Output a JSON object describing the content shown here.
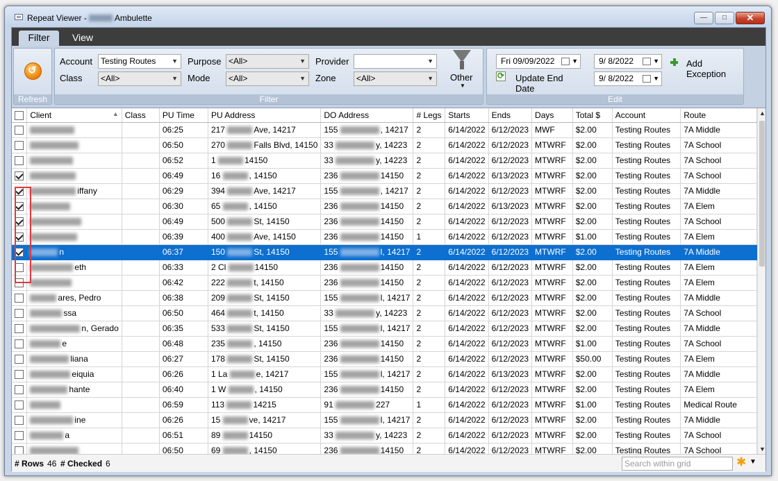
{
  "window": {
    "title_prefix": "Repeat Viewer -",
    "title_suffix": "Ambulette",
    "controls": {
      "minimize": "—",
      "maximize": "□",
      "close": "✕"
    }
  },
  "tabs": [
    {
      "label": "Filter",
      "active": true
    },
    {
      "label": "View",
      "active": false
    }
  ],
  "ribbon": {
    "refresh_caption": "Refresh",
    "filter": {
      "caption": "Filter",
      "account_label": "Account",
      "account_value": "Testing Routes",
      "class_label": "Class",
      "class_value": "<All>",
      "purpose_label": "Purpose",
      "purpose_value": "<All>",
      "mode_label": "Mode",
      "mode_value": "<All>",
      "provider_label": "Provider",
      "provider_value": "",
      "zone_label": "Zone",
      "zone_value": "<All>",
      "other_label": "Other"
    },
    "edit": {
      "caption": "Edit",
      "end_date_value": "Fri  09/09/2022",
      "update_end_date_label": "Update End Date",
      "exception_date1": "9/  8/2022",
      "exception_date2": "9/  8/2022",
      "add_exception_label": "Add Exception"
    }
  },
  "grid": {
    "columns": [
      "Client",
      "Class",
      "PU Time",
      "PU Address",
      "DO Address",
      "# Legs",
      "Starts",
      "Ends",
      "Days",
      "Total $",
      "Account",
      "Route"
    ],
    "rows": [
      {
        "checked": false,
        "selected": false,
        "client": "",
        "pu_time": "06:25",
        "pu_pre": "217",
        "pu_post": "Ave, 14217",
        "do_pre": "155",
        "do_post": ", 14217",
        "legs": "2",
        "starts": "6/14/2022",
        "ends": "6/12/2023",
        "days": "MWF",
        "total": "$2.00",
        "account": "Testing Routes",
        "route": "7A Middle"
      },
      {
        "checked": false,
        "selected": false,
        "client": "",
        "pu_time": "06:50",
        "pu_pre": "270",
        "pu_post": "Falls Blvd, 14150",
        "do_pre": "33",
        "do_post": "y, 14223",
        "legs": "2",
        "starts": "6/14/2022",
        "ends": "6/12/2023",
        "days": "MTWRF",
        "total": "$2.00",
        "account": "Testing Routes",
        "route": "7A School"
      },
      {
        "checked": false,
        "selected": false,
        "client": "",
        "pu_time": "06:52",
        "pu_pre": "1",
        "pu_post": "14150",
        "do_pre": "33",
        "do_post": "y, 14223",
        "legs": "2",
        "starts": "6/14/2022",
        "ends": "6/12/2023",
        "days": "MTWRF",
        "total": "$2.00",
        "account": "Testing Routes",
        "route": "7A School"
      },
      {
        "checked": true,
        "selected": false,
        "client": "",
        "pu_time": "06:49",
        "pu_pre": "16",
        "pu_post": ", 14150",
        "do_pre": "236",
        "do_post": "14150",
        "legs": "2",
        "starts": "6/14/2022",
        "ends": "6/13/2023",
        "days": "MTWRF",
        "total": "$2.00",
        "account": "Testing Routes",
        "route": "7A School"
      },
      {
        "checked": true,
        "selected": false,
        "client": "iffany",
        "pu_time": "06:29",
        "pu_pre": "394",
        "pu_post": "Ave, 14217",
        "do_pre": "155",
        "do_post": ", 14217",
        "legs": "2",
        "starts": "6/14/2022",
        "ends": "6/12/2023",
        "days": "MTWRF",
        "total": "$2.00",
        "account": "Testing Routes",
        "route": "7A Middle"
      },
      {
        "checked": true,
        "selected": false,
        "client": "",
        "pu_time": "06:30",
        "pu_pre": "65",
        "pu_post": ", 14150",
        "do_pre": "236",
        "do_post": "14150",
        "legs": "2",
        "starts": "6/14/2022",
        "ends": "6/13/2023",
        "days": "MTWRF",
        "total": "$2.00",
        "account": "Testing Routes",
        "route": "7A Elem"
      },
      {
        "checked": true,
        "selected": false,
        "client": "",
        "pu_time": "06:49",
        "pu_pre": "500",
        "pu_post": "St, 14150",
        "do_pre": "236",
        "do_post": "14150",
        "legs": "2",
        "starts": "6/14/2022",
        "ends": "6/12/2023",
        "days": "MTWRF",
        "total": "$2.00",
        "account": "Testing Routes",
        "route": "7A School"
      },
      {
        "checked": true,
        "selected": false,
        "client": "",
        "pu_time": "06:39",
        "pu_pre": "400",
        "pu_post": "Ave, 14150",
        "do_pre": "236",
        "do_post": "14150",
        "legs": "1",
        "starts": "6/14/2022",
        "ends": "6/12/2023",
        "days": "MTWRF",
        "total": "$1.00",
        "account": "Testing Routes",
        "route": "7A Elem"
      },
      {
        "checked": true,
        "selected": true,
        "client": "n",
        "pu_time": "06:37",
        "pu_pre": "150",
        "pu_post": "St, 14150",
        "do_pre": "155",
        "do_post": "l, 14217",
        "legs": "2",
        "starts": "6/14/2022",
        "ends": "6/12/2023",
        "days": "MTWRF",
        "total": "$2.00",
        "account": "Testing Routes",
        "route": "7A Middle"
      },
      {
        "checked": false,
        "selected": false,
        "client": "eth",
        "pu_time": "06:33",
        "pu_pre": "2 Cl",
        "pu_post": "14150",
        "do_pre": "236",
        "do_post": "14150",
        "legs": "2",
        "starts": "6/14/2022",
        "ends": "6/12/2023",
        "days": "MTWRF",
        "total": "$2.00",
        "account": "Testing Routes",
        "route": "7A Elem"
      },
      {
        "checked": false,
        "selected": false,
        "client": "",
        "pu_time": "06:42",
        "pu_pre": "222",
        "pu_post": "t, 14150",
        "do_pre": "236",
        "do_post": "14150",
        "legs": "2",
        "starts": "6/14/2022",
        "ends": "6/12/2023",
        "days": "MTWRF",
        "total": "$2.00",
        "account": "Testing Routes",
        "route": "7A Elem"
      },
      {
        "checked": false,
        "selected": false,
        "client": "ares, Pedro",
        "pu_time": "06:38",
        "pu_pre": "209",
        "pu_post": "St, 14150",
        "do_pre": "155",
        "do_post": "l, 14217",
        "legs": "2",
        "starts": "6/14/2022",
        "ends": "6/12/2023",
        "days": "MTWRF",
        "total": "$2.00",
        "account": "Testing Routes",
        "route": "7A Middle"
      },
      {
        "checked": false,
        "selected": false,
        "client": "ssa",
        "pu_time": "06:50",
        "pu_pre": "464",
        "pu_post": "t, 14150",
        "do_pre": "33",
        "do_post": "y, 14223",
        "legs": "2",
        "starts": "6/14/2022",
        "ends": "6/12/2023",
        "days": "MTWRF",
        "total": "$2.00",
        "account": "Testing Routes",
        "route": "7A School"
      },
      {
        "checked": false,
        "selected": false,
        "client": "n, Gerado",
        "pu_time": "06:35",
        "pu_pre": "533",
        "pu_post": "St, 14150",
        "do_pre": "155",
        "do_post": "l, 14217",
        "legs": "2",
        "starts": "6/14/2022",
        "ends": "6/12/2023",
        "days": "MTWRF",
        "total": "$2.00",
        "account": "Testing Routes",
        "route": "7A Middle"
      },
      {
        "checked": false,
        "selected": false,
        "client": "e",
        "pu_time": "06:48",
        "pu_pre": "235",
        "pu_post": ", 14150",
        "do_pre": "236",
        "do_post": "14150",
        "legs": "2",
        "starts": "6/14/2022",
        "ends": "6/12/2023",
        "days": "MTWRF",
        "total": "$1.00",
        "account": "Testing Routes",
        "route": "7A School"
      },
      {
        "checked": false,
        "selected": false,
        "client": "liana",
        "pu_time": "06:27",
        "pu_pre": "178",
        "pu_post": "St, 14150",
        "do_pre": "236",
        "do_post": "14150",
        "legs": "2",
        "starts": "6/14/2022",
        "ends": "6/12/2023",
        "days": "MTWRF",
        "total": "$50.00",
        "account": "Testing Routes",
        "route": "7A Elem"
      },
      {
        "checked": false,
        "selected": false,
        "client": "eiquia",
        "pu_time": "06:26",
        "pu_pre": "1 La",
        "pu_post": "e, 14217",
        "do_pre": "155",
        "do_post": "l, 14217",
        "legs": "2",
        "starts": "6/14/2022",
        "ends": "6/13/2023",
        "days": "MTWRF",
        "total": "$2.00",
        "account": "Testing Routes",
        "route": "7A Middle"
      },
      {
        "checked": false,
        "selected": false,
        "client": "hante",
        "pu_time": "06:40",
        "pu_pre": "1 W",
        "pu_post": ", 14150",
        "do_pre": "236",
        "do_post": "14150",
        "legs": "2",
        "starts": "6/14/2022",
        "ends": "6/12/2023",
        "days": "MTWRF",
        "total": "$2.00",
        "account": "Testing Routes",
        "route": "7A Elem"
      },
      {
        "checked": false,
        "selected": false,
        "client": "",
        "pu_time": "06:59",
        "pu_pre": "113",
        "pu_post": "14215",
        "do_pre": "91",
        "do_post": "227",
        "legs": "1",
        "starts": "6/14/2022",
        "ends": "6/12/2023",
        "days": "MTWRF",
        "total": "$1.00",
        "account": "Testing Routes",
        "route": "Medical Route"
      },
      {
        "checked": false,
        "selected": false,
        "client": "ine",
        "pu_time": "06:26",
        "pu_pre": "15",
        "pu_post": "ve, 14217",
        "do_pre": "155",
        "do_post": "l, 14217",
        "legs": "2",
        "starts": "6/14/2022",
        "ends": "6/12/2023",
        "days": "MTWRF",
        "total": "$2.00",
        "account": "Testing Routes",
        "route": "7A Middle"
      },
      {
        "checked": false,
        "selected": false,
        "client": "a",
        "pu_time": "06:51",
        "pu_pre": "89",
        "pu_post": "14150",
        "do_pre": "33",
        "do_post": "y, 14223",
        "legs": "2",
        "starts": "6/14/2022",
        "ends": "6/12/2023",
        "days": "MTWRF",
        "total": "$2.00",
        "account": "Testing Routes",
        "route": "7A School"
      },
      {
        "checked": false,
        "selected": false,
        "client": "",
        "pu_time": "06:50",
        "pu_pre": "69",
        "pu_post": ", 14150",
        "do_pre": "236",
        "do_post": "14150",
        "legs": "2",
        "starts": "6/14/2022",
        "ends": "6/12/2023",
        "days": "MTWRF",
        "total": "$2.00",
        "account": "Testing Routes",
        "route": "7A School"
      }
    ]
  },
  "status": {
    "rows_label": "# Rows",
    "rows_value": "46",
    "checked_label": "# Checked",
    "checked_value": "6",
    "search_placeholder": "Search within grid"
  },
  "colors": {
    "selection": "#0d6fcf",
    "highlight_box": "#e0383f",
    "tab_strip": "#3d3d3d"
  },
  "icons": [
    "app-icon",
    "refresh-icon",
    "funnel-icon",
    "calendar-icon",
    "update-icon",
    "add-exception-icon",
    "grid-options-icon",
    "sort-ascending-icon"
  ]
}
